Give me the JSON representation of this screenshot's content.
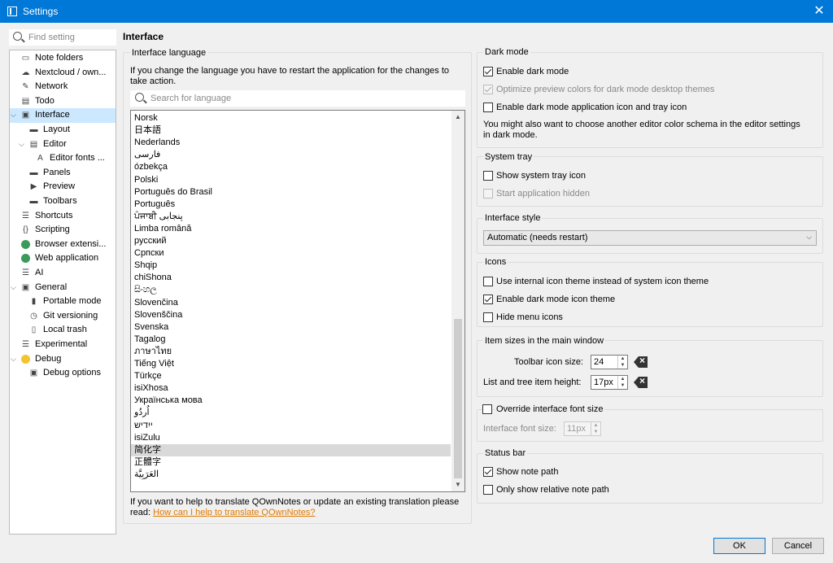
{
  "window": {
    "title": "Settings",
    "close_glyph": "✕"
  },
  "sidebar": {
    "search_placeholder": "Find setting",
    "items": [
      {
        "label": "Note folders",
        "icon": "folder-icon",
        "level": 0
      },
      {
        "label": "Nextcloud / own...",
        "icon": "cloud-icon",
        "level": 0
      },
      {
        "label": "Network",
        "icon": "network-icon",
        "level": 0
      },
      {
        "label": "Todo",
        "icon": "todo-icon",
        "level": 0
      },
      {
        "label": "Interface",
        "icon": "interface-icon",
        "level": 0,
        "expanded": true,
        "selected": true
      },
      {
        "label": "Layout",
        "icon": "layout-icon",
        "level": 1
      },
      {
        "label": "Editor",
        "icon": "editor-icon",
        "level": 1,
        "expanded": true
      },
      {
        "label": "Editor fonts ...",
        "icon": "font-icon",
        "level": 2
      },
      {
        "label": "Panels",
        "icon": "panels-icon",
        "level": 1
      },
      {
        "label": "Preview",
        "icon": "preview-icon",
        "level": 1
      },
      {
        "label": "Toolbars",
        "icon": "toolbars-icon",
        "level": 1
      },
      {
        "label": "Shortcuts",
        "icon": "shortcuts-icon",
        "level": 0
      },
      {
        "label": "Scripting",
        "icon": "scripting-icon",
        "level": 0
      },
      {
        "label": "Browser extensi...",
        "icon": "globe-icon",
        "level": 0
      },
      {
        "label": "Web application",
        "icon": "globe-icon",
        "level": 0
      },
      {
        "label": "AI",
        "icon": "ai-icon",
        "level": 0
      },
      {
        "label": "General",
        "icon": "general-icon",
        "level": 0,
        "expanded": true
      },
      {
        "label": "Portable mode",
        "icon": "portable-icon",
        "level": 1
      },
      {
        "label": "Git versioning",
        "icon": "git-icon",
        "level": 1
      },
      {
        "label": "Local trash",
        "icon": "trash-icon",
        "level": 1
      },
      {
        "label": "Experimental",
        "icon": "experimental-icon",
        "level": 0
      },
      {
        "label": "Debug",
        "icon": "debug-icon",
        "level": 0,
        "expanded": true
      },
      {
        "label": "Debug options",
        "icon": "debug-options-icon",
        "level": 1
      }
    ]
  },
  "page_title": "Interface",
  "language": {
    "group_title": "Interface language",
    "info": "If you change the language you have to restart the application for the changes to take action.",
    "search_placeholder": "Search for language",
    "items": [
      "Norsk",
      "日本語",
      "Nederlands",
      "فارسی",
      "ózbekça",
      "Polski",
      "Português do Brasil",
      "Português",
      "ਪੰਜਾਬੀ پنجابی",
      "Limba română",
      "русский",
      "Српски",
      "Shqip",
      "chiShona",
      "සිංහල",
      "Slovenčina",
      "Slovenščina",
      "Svenska",
      "Tagalog",
      "ภาษาไทย",
      "Tiếng Việt",
      "Türkçe",
      "isiXhosa",
      "Українська мова",
      "اُردُو",
      "ייִדיש",
      "isiZulu",
      "简化字",
      "正體字",
      "العَرَبِيَّة"
    ],
    "selected": "简化字",
    "footer_text": "If you want to help to translate QOwnNotes or update an existing translation please read:",
    "footer_link": "How can I help to translate QOwnNotes?"
  },
  "dark_mode": {
    "title": "Dark mode",
    "enable": {
      "label": "Enable dark mode",
      "checked": true
    },
    "optimize": {
      "label": "Optimize preview colors for dark mode desktop themes",
      "checked": true,
      "disabled": true
    },
    "tray_icon": {
      "label": "Enable dark mode application icon and tray icon",
      "checked": false
    },
    "note": "You might also want to choose another editor color schema in the editor settings in dark mode."
  },
  "system_tray": {
    "title": "System tray",
    "show": {
      "label": "Show system tray icon",
      "checked": false
    },
    "hidden": {
      "label": "Start application hidden",
      "checked": false,
      "disabled": true
    }
  },
  "interface_style": {
    "title": "Interface style",
    "value": "Automatic (needs restart)"
  },
  "icons": {
    "title": "Icons",
    "internal": {
      "label": "Use internal icon theme instead of system icon theme",
      "checked": false
    },
    "dark": {
      "label": "Enable dark mode icon theme",
      "checked": true
    },
    "hide_menu": {
      "label": "Hide menu icons",
      "checked": false
    }
  },
  "item_sizes": {
    "title": "Item sizes in the main window",
    "toolbar_label": "Toolbar icon size:",
    "toolbar_value": "24",
    "list_label": "List and tree item height:",
    "list_value": "17px"
  },
  "font": {
    "override_label": "Override interface font size",
    "override_checked": false,
    "size_label": "Interface font size:",
    "size_value": "11px"
  },
  "status_bar": {
    "title": "Status bar",
    "note_path": {
      "label": "Show note path",
      "checked": true
    },
    "relative": {
      "label": "Only show relative note path",
      "checked": false
    }
  },
  "buttons": {
    "ok": "OK",
    "cancel": "Cancel"
  }
}
